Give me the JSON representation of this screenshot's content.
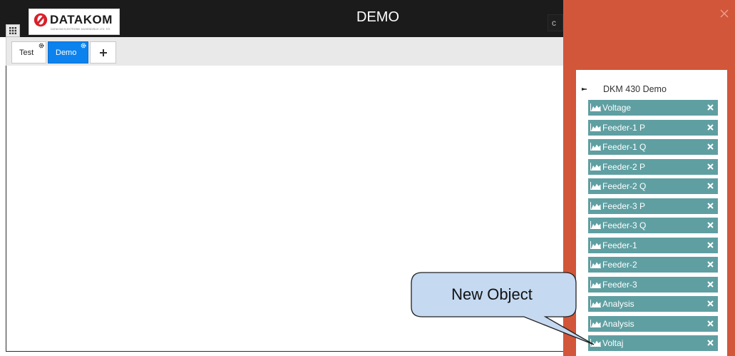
{
  "header": {
    "title": "DEMO",
    "search_partial": "c",
    "menu_icon": "grid-icon",
    "background": "#1b1b1b"
  },
  "logo": {
    "name": "DATAKOM",
    "tagline": "DATAKOM ELEKTRONIK MUHENDISLIK LTD. STI."
  },
  "tabs": [
    {
      "label": "Test",
      "active": false,
      "icon": "gear-icon"
    },
    {
      "label": "Demo",
      "active": true,
      "icon": "gear-icon"
    }
  ],
  "add_tab": {
    "icon": "plus-icon"
  },
  "side_panel": {
    "background": "#d2563a",
    "close_icon": "close-icon",
    "tree_root": {
      "label": "DKM 430 Demo",
      "icon": "arrow-right-icon"
    },
    "item_color": "#5f9fa2",
    "items": [
      {
        "label": "Voltage",
        "icon": "chart-area-icon"
      },
      {
        "label": "Feeder-1 P",
        "icon": "chart-area-icon"
      },
      {
        "label": "Feeder-1 Q",
        "icon": "chart-area-icon"
      },
      {
        "label": "Feeder-2 P",
        "icon": "chart-area-icon"
      },
      {
        "label": "Feeder-2 Q",
        "icon": "chart-area-icon"
      },
      {
        "label": "Feeder-3 P",
        "icon": "chart-area-icon"
      },
      {
        "label": "Feeder-3 Q",
        "icon": "chart-area-icon"
      },
      {
        "label": "Feeder-1",
        "icon": "chart-area-icon"
      },
      {
        "label": "Feeder-2",
        "icon": "chart-area-icon"
      },
      {
        "label": "Feeder-3",
        "icon": "chart-area-icon"
      },
      {
        "label": "Analysis",
        "icon": "chart-area-icon"
      },
      {
        "label": "Analysis",
        "icon": "chart-area-icon"
      },
      {
        "label": "Voltaj",
        "icon": "chart-area-icon"
      }
    ]
  },
  "callout": {
    "text": "New Object",
    "fill": "#c5d9f1"
  }
}
